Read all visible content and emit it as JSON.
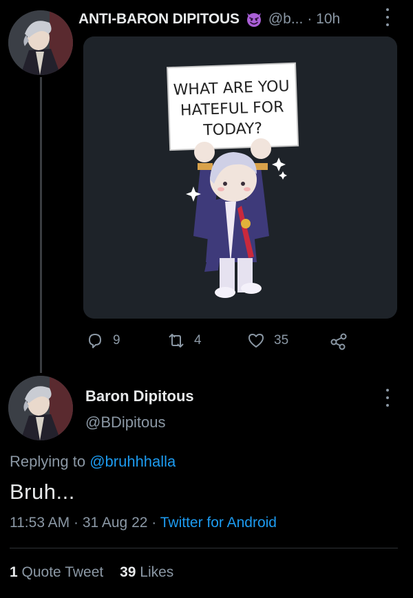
{
  "tweet": {
    "author_name": "ANTI-BARON DIPITOUS",
    "handle": "@b...",
    "time": "· 10h",
    "emoji_icon": "smiling-imp-emoji",
    "image": {
      "sign_lines": [
        "WHAT ARE YOU",
        "HATEFUL FOR",
        "TODAY?"
      ]
    },
    "actions": {
      "replies": "9",
      "retweets": "4",
      "likes": "35"
    }
  },
  "reply": {
    "author_name": "Baron Dipitous",
    "handle": "@BDipitous",
    "replying_prefix": "Replying to",
    "replying_to": "@bruhhhalla",
    "text": "Bruh...",
    "timestamp": "11:53 AM · 31 Aug 22 ·",
    "client": "Twitter for Android",
    "quote_count": "1",
    "quote_label": "Quote Tweet",
    "like_count": "39",
    "like_label": "Likes"
  },
  "colors": {
    "background": "#000000",
    "text": "#e7e9ea",
    "muted": "#8b98a5",
    "link": "#1d9bf0",
    "media_bg": "#1e2329"
  }
}
